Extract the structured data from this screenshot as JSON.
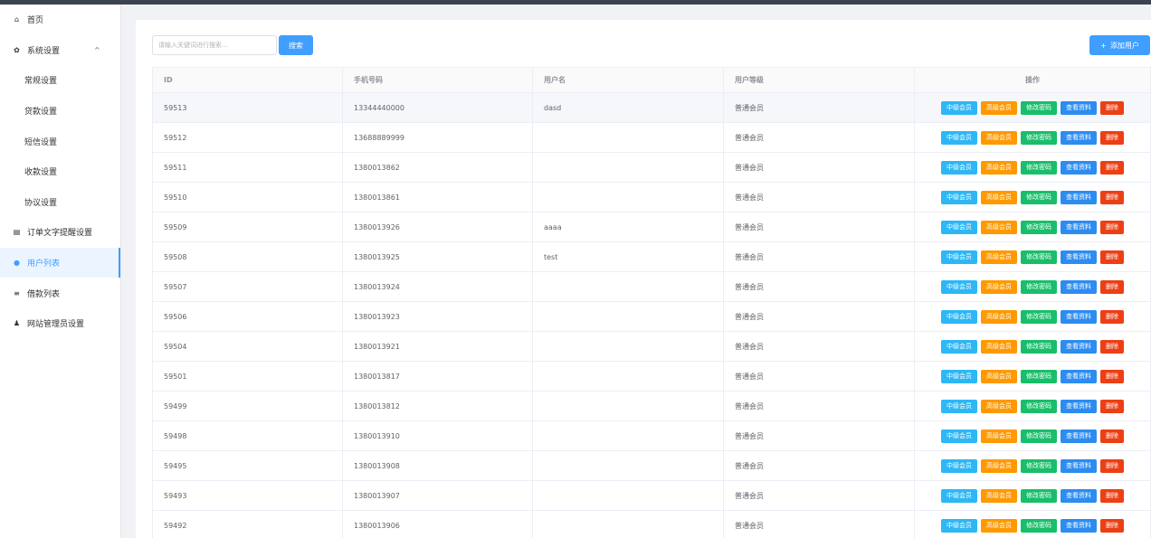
{
  "sidebar": {
    "items": [
      {
        "label": "首页",
        "icon": "home-icon",
        "glyph": "⌂",
        "sub": false,
        "active": false
      },
      {
        "label": "系统设置",
        "icon": "gear-icon",
        "glyph": "✿",
        "sub": false,
        "active": false,
        "chevron": "^"
      },
      {
        "label": "常规设置",
        "sub": true,
        "active": false
      },
      {
        "label": "贷款设置",
        "sub": true,
        "active": false
      },
      {
        "label": "短信设置",
        "sub": true,
        "active": false
      },
      {
        "label": "收款设置",
        "sub": true,
        "active": false
      },
      {
        "label": "协议设置",
        "sub": true,
        "active": false
      },
      {
        "label": "订单文字提醒设置",
        "icon": "document-icon",
        "glyph": "▤",
        "sub": false,
        "active": false
      },
      {
        "label": "用户列表",
        "icon": "users-icon",
        "glyph": "●",
        "sub": false,
        "active": true
      },
      {
        "label": "借款列表",
        "icon": "list-icon",
        "glyph": "≡",
        "sub": false,
        "active": false
      },
      {
        "label": "网站管理员设置",
        "icon": "user-icon",
        "glyph": "♟",
        "sub": false,
        "active": false
      }
    ]
  },
  "toolbar": {
    "search_placeholder": "请输入关键词进行搜索...",
    "search_label": "搜索",
    "add_user_label": "添加用户",
    "add_user_icon": "+"
  },
  "table": {
    "columns": [
      "ID",
      "手机号码",
      "用户名",
      "用户等级",
      "操作"
    ],
    "actions": {
      "mid": "中级会员",
      "high": "高级会员",
      "pwd": "修改密码",
      "view": "查看资料",
      "del": "删除"
    },
    "rows": [
      {
        "id": "59513",
        "phone": "13344440000",
        "username": "dasd",
        "level": "普通会员"
      },
      {
        "id": "59512",
        "phone": "13688889999",
        "username": "",
        "level": "普通会员"
      },
      {
        "id": "59511",
        "phone": "1380013862",
        "username": "",
        "level": "普通会员"
      },
      {
        "id": "59510",
        "phone": "1380013861",
        "username": "",
        "level": "普通会员"
      },
      {
        "id": "59509",
        "phone": "1380013926",
        "username": "aaaa",
        "level": "普通会员"
      },
      {
        "id": "59508",
        "phone": "1380013925",
        "username": "test",
        "level": "普通会员"
      },
      {
        "id": "59507",
        "phone": "1380013924",
        "username": "",
        "level": "普通会员"
      },
      {
        "id": "59506",
        "phone": "1380013923",
        "username": "",
        "level": "普通会员"
      },
      {
        "id": "59504",
        "phone": "1380013921",
        "username": "",
        "level": "普通会员"
      },
      {
        "id": "59501",
        "phone": "1380013817",
        "username": "",
        "level": "普通会员"
      },
      {
        "id": "59499",
        "phone": "1380013812",
        "username": "",
        "level": "普通会员"
      },
      {
        "id": "59498",
        "phone": "1380013910",
        "username": "",
        "level": "普通会员"
      },
      {
        "id": "59495",
        "phone": "1380013908",
        "username": "",
        "level": "普通会员"
      },
      {
        "id": "59493",
        "phone": "1380013907",
        "username": "",
        "level": "普通会员"
      },
      {
        "id": "59492",
        "phone": "1380013906",
        "username": "",
        "level": "普通会员"
      }
    ]
  }
}
